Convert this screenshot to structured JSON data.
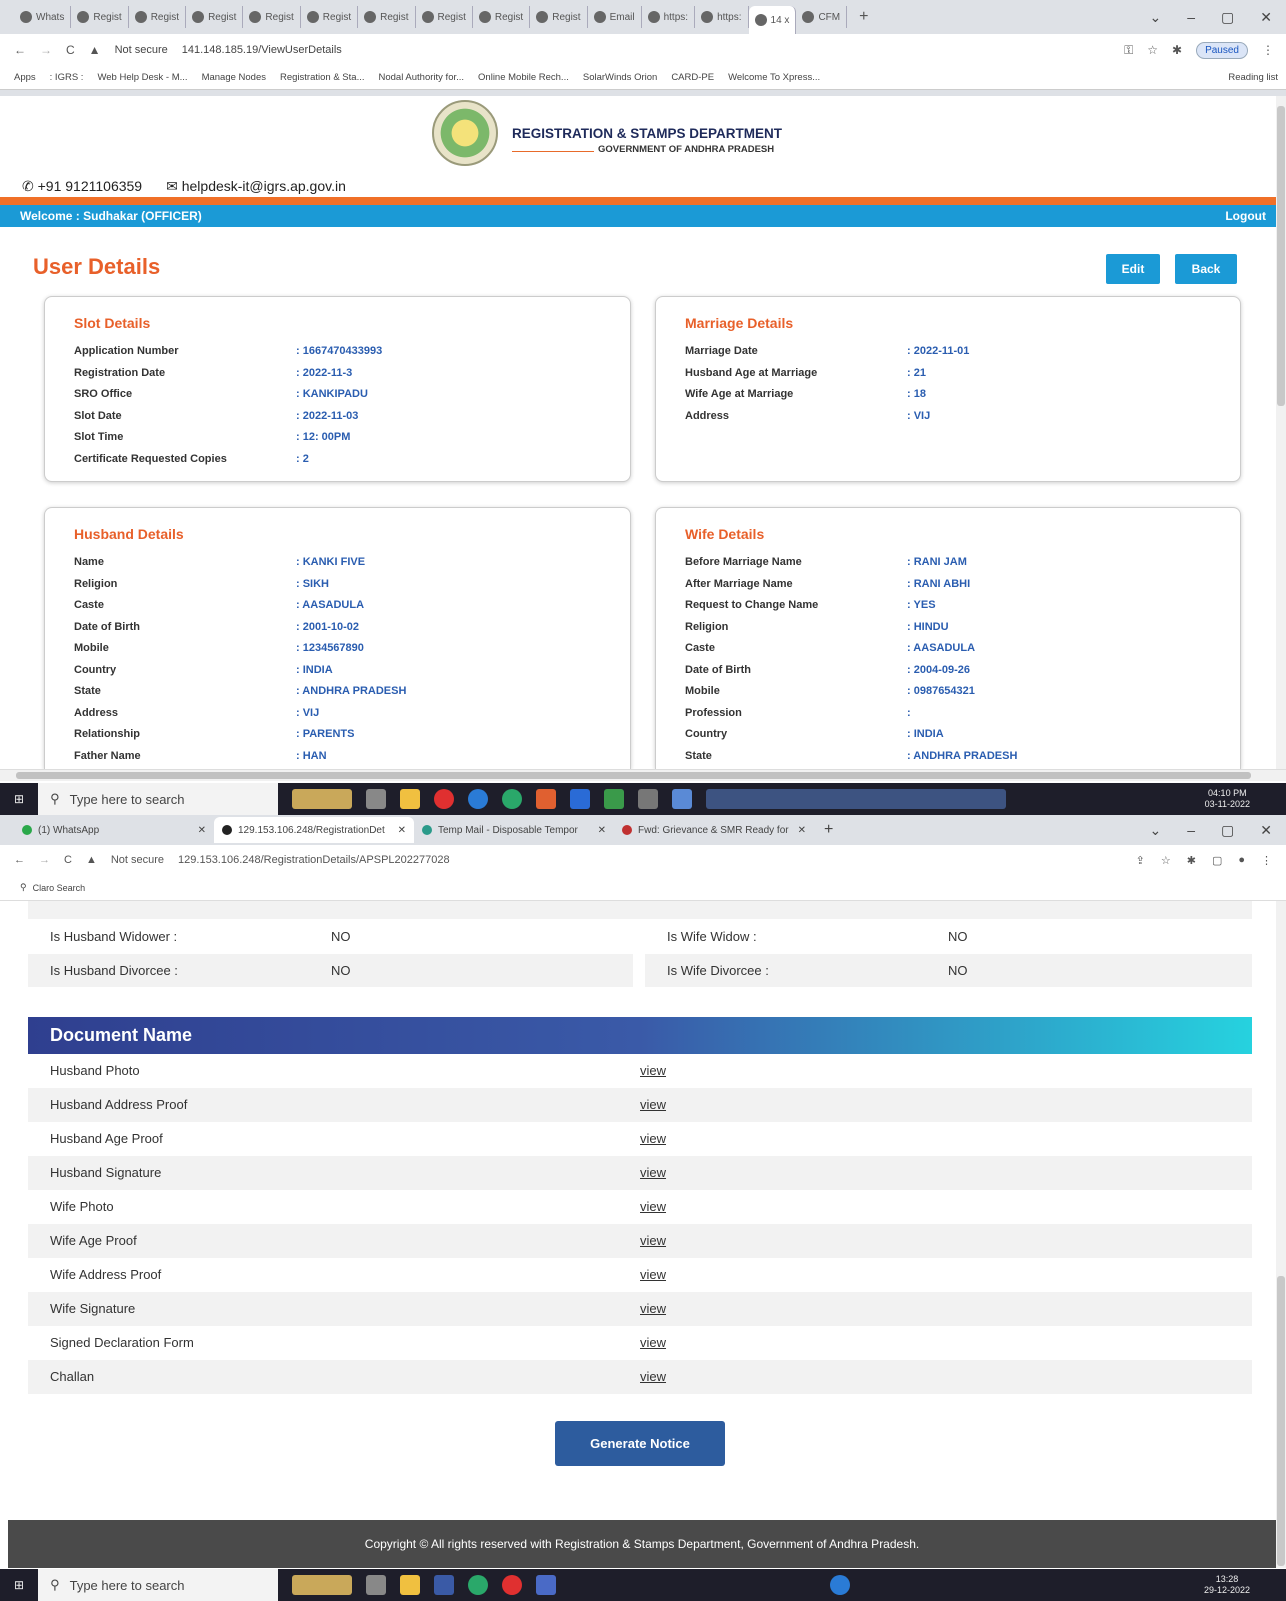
{
  "screen1": {
    "tabs": [
      "Whats",
      "Regist",
      "Regist",
      "Regist",
      "Regist",
      "Regist",
      "Regist",
      "Regist",
      "Regist",
      "Regist",
      "Email",
      "https:",
      "https:",
      "14 x",
      "CFM"
    ],
    "address": {
      "security": "Not secure",
      "url": "141.148.185.19/ViewUserDetails"
    },
    "profile_status": "Paused",
    "bookmarks": [
      "Apps",
      ": IGRS :",
      "Web Help Desk - M...",
      "Manage Nodes",
      "Registration & Sta...",
      "Nodal Authority for...",
      "Online Mobile Rech...",
      "SolarWinds Orion",
      "CARD-PE",
      "Welcome To Xpress..."
    ],
    "reading_list": "Reading list",
    "header": {
      "dept_name": "REGISTRATION & STAMPS DEPARTMENT",
      "gov_name": "GOVERNMENT OF ANDHRA PRADESH",
      "phone": "+91 9121106359",
      "email": "helpdesk-it@igrs.ap.gov.in"
    },
    "welcome": "Welcome : Sudhakar (OFFICER)",
    "logout": "Logout",
    "page_title": "User Details",
    "edit": "Edit",
    "back": "Back",
    "slot": {
      "title": "Slot Details",
      "rows": [
        {
          "k": "Application Number",
          "v": ": 1667470433993"
        },
        {
          "k": "Registration Date",
          "v": ": 2022-11-3"
        },
        {
          "k": "SRO Office",
          "v": ": KANKIPADU"
        },
        {
          "k": "Slot Date",
          "v": ": 2022-11-03"
        },
        {
          "k": "Slot Time",
          "v": ": 12: 00PM"
        },
        {
          "k": "Certificate Requested Copies",
          "v": ": 2"
        }
      ]
    },
    "marriage": {
      "title": "Marriage Details",
      "rows": [
        {
          "k": "Marriage Date",
          "v": ": 2022-11-01"
        },
        {
          "k": "Husband Age at Marriage",
          "v": ": 21"
        },
        {
          "k": "Wife Age at Marriage",
          "v": ": 18"
        },
        {
          "k": "Address",
          "v": ": VIJ"
        }
      ]
    },
    "husband": {
      "title": "Husband Details",
      "rows": [
        {
          "k": "Name",
          "v": ": KANKI FIVE"
        },
        {
          "k": "Religion",
          "v": ": SIKH"
        },
        {
          "k": "Caste",
          "v": ": AASADULA"
        },
        {
          "k": "Date of Birth",
          "v": ": 2001-10-02"
        },
        {
          "k": "Mobile",
          "v": ": 1234567890"
        },
        {
          "k": "Country",
          "v": ": INDIA"
        },
        {
          "k": "State",
          "v": ": ANDHRA PRADESH"
        },
        {
          "k": "Address",
          "v": ": VIJ"
        },
        {
          "k": "Relationship",
          "v": ": PARENTS"
        },
        {
          "k": "Father Name",
          "v": ": HAN"
        }
      ]
    },
    "wife": {
      "title": "Wife Details",
      "rows": [
        {
          "k": "Before Marriage Name",
          "v": ": RANI JAM"
        },
        {
          "k": "After Marriage Name",
          "v": ": RANI ABHI"
        },
        {
          "k": "Request to Change Name",
          "v": ": YES"
        },
        {
          "k": "Religion",
          "v": ": HINDU"
        },
        {
          "k": "Caste",
          "v": ": AASADULA"
        },
        {
          "k": "Date of Birth",
          "v": ": 2004-09-26"
        },
        {
          "k": "Mobile",
          "v": ": 0987654321"
        },
        {
          "k": "Profession",
          "v": ":"
        },
        {
          "k": "Country",
          "v": ": INDIA"
        },
        {
          "k": "State",
          "v": ": ANDHRA PRADESH"
        }
      ]
    },
    "taskbar": {
      "search": "Type here to search",
      "time": "04:10 PM",
      "date": "03-11-2022"
    }
  },
  "screen2": {
    "tabs": [
      {
        "label": "(1) WhatsApp"
      },
      {
        "label": "129.153.106.248/RegistrationDet"
      },
      {
        "label": "Temp Mail - Disposable Tempor"
      },
      {
        "label": "Fwd: Grievance & SMR Ready for"
      }
    ],
    "address": {
      "security": "Not secure",
      "url": "129.153.106.248/RegistrationDetails/APSPL202277028"
    },
    "claro": "Claro Search",
    "rows": [
      {
        "l1": "Is Husband Widower :",
        "v1": "NO",
        "l2": "Is Wife Widow :",
        "v2": "NO"
      },
      {
        "l1": "Is Husband Divorcee :",
        "v1": "NO",
        "l2": "Is Wife Divorcee :",
        "v2": "NO"
      }
    ],
    "doc_header": "Document Name",
    "view_label": "view",
    "documents": [
      "Husband Photo",
      "Husband Address Proof",
      "Husband Age Proof",
      "Husband Signature",
      "Wife Photo",
      "Wife Age Proof",
      "Wife Address Proof",
      "Wife Signature",
      "Signed Declaration Form",
      "Challan"
    ],
    "generate": "Generate Notice",
    "footer": "Copyright © All rights reserved with Registration & Stamps Department, Government of Andhra Pradesh.",
    "taskbar": {
      "search": "Type here to search",
      "time": "13:28",
      "date": "29-12-2022"
    }
  },
  "colors": {
    "accent_orange": "#e8602a",
    "accent_blue": "#1b9ad6",
    "value_blue": "#2a5db0"
  }
}
